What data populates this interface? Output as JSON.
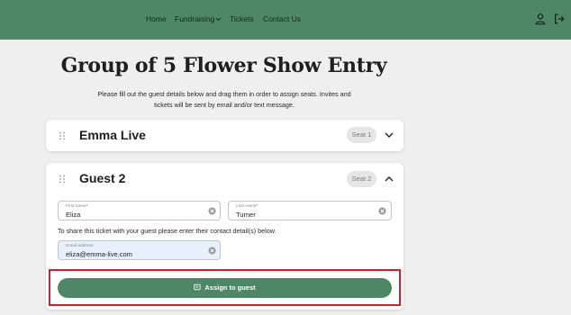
{
  "header": {
    "nav": [
      "Home",
      "Fundraising",
      "Tickets",
      "Contact Us"
    ],
    "icons": [
      "chevron-down-icon",
      "user-icon",
      "logout-icon"
    ]
  },
  "page": {
    "title": "Group of 5 Flower Show Entry",
    "intro_line_1": "Please fill out the guest details below and drag them in order to assign seats. Invites and",
    "intro_line_2": "tickets will be sent by email and/or text message."
  },
  "guests": [
    {
      "name": "Emma Live",
      "seat": "Seat 1",
      "expanded": false
    },
    {
      "name": "Guest 2",
      "seat": "Seat 2",
      "expanded": true,
      "first_name": {
        "label": "First name",
        "required_mark": "*",
        "value": "Eliza"
      },
      "last_name": {
        "label": "Last name",
        "required_mark": "*",
        "value": "Turner"
      },
      "share_note": "To share this ticket with your guest please enter their contact detail(s) below.",
      "email": {
        "label": "Email address",
        "value": "eliza@emma-live.com"
      },
      "assign_label": "Assign to guest"
    }
  ],
  "colors": {
    "brand_green": "#4e8765",
    "highlight_red": "#d0202e",
    "email_field_bg": "#e8f0fb"
  }
}
